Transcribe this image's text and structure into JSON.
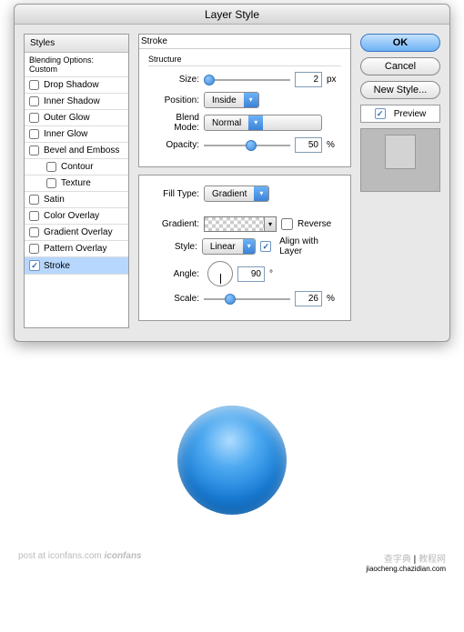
{
  "dialog": {
    "title": "Layer Style"
  },
  "sidebar": {
    "header": "Styles",
    "blending": "Blending Options: Custom",
    "items": [
      {
        "label": "Drop Shadow",
        "checked": false
      },
      {
        "label": "Inner Shadow",
        "checked": false
      },
      {
        "label": "Outer Glow",
        "checked": false
      },
      {
        "label": "Inner Glow",
        "checked": false
      },
      {
        "label": "Bevel and Emboss",
        "checked": false
      },
      {
        "label": "Contour",
        "checked": false,
        "indent": true
      },
      {
        "label": "Texture",
        "checked": false,
        "indent": true
      },
      {
        "label": "Satin",
        "checked": false
      },
      {
        "label": "Color Overlay",
        "checked": false
      },
      {
        "label": "Gradient Overlay",
        "checked": false
      },
      {
        "label": "Pattern Overlay",
        "checked": false
      },
      {
        "label": "Stroke",
        "checked": true,
        "selected": true
      }
    ]
  },
  "stroke": {
    "panel_title": "Stroke",
    "structure_label": "Structure",
    "size_label": "Size:",
    "size_value": "2",
    "size_unit": "px",
    "position_label": "Position:",
    "position_value": "Inside",
    "blend_label": "Blend Mode:",
    "blend_value": "Normal",
    "opacity_label": "Opacity:",
    "opacity_value": "50",
    "opacity_unit": "%",
    "filltype_label": "Fill Type:",
    "filltype_value": "Gradient",
    "gradient_label": "Gradient:",
    "reverse_label": "Reverse",
    "style_label": "Style:",
    "style_value": "Linear",
    "align_label": "Align with Layer",
    "angle_label": "Angle:",
    "angle_value": "90",
    "angle_unit": "°",
    "scale_label": "Scale:",
    "scale_value": "26",
    "scale_unit": "%"
  },
  "buttons": {
    "ok": "OK",
    "cancel": "Cancel",
    "newstyle": "New Style...",
    "preview": "Preview"
  },
  "footer": {
    "left": "post at iconfans.com",
    "left_brand": "iconfans",
    "right_a": "查字典",
    "right_b": "教程网",
    "right_url": "jiaocheng.chazidian.com"
  }
}
